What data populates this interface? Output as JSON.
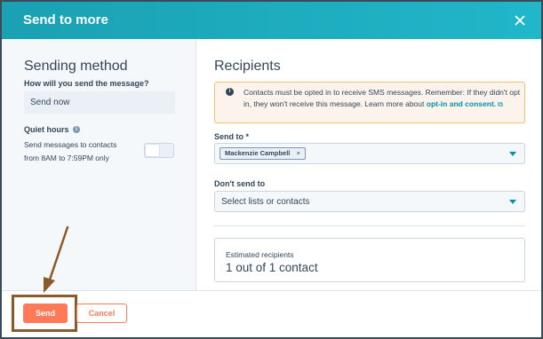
{
  "header": {
    "title": "Send to more",
    "close_icon": "close-icon"
  },
  "sending_method": {
    "title": "Sending method",
    "how_label": "How will you send the message?",
    "method_value": "Send now",
    "quiet_hours_label": "Quiet hours",
    "quiet_hours_info_icon": "info-icon",
    "quiet_hours_desc_line1": "Send messages to contacts",
    "quiet_hours_desc_line2": "from 8AM to 7:59PM only",
    "quiet_hours_enabled": false
  },
  "recipients": {
    "title": "Recipients",
    "alert_icon": "info-icon",
    "alert_text": "Contacts must be opted in to receive SMS messages. Remember: If they didn't opt in, they won't receive this message. Learn more about",
    "alert_link": "opt-in and consent.",
    "send_to_label": "Send to *",
    "send_to_chip": "Mackenzie Campbell",
    "chip_remove": "×",
    "dont_send_label": "Don't send to",
    "dont_send_placeholder": "Select lists or contacts",
    "estimated_label": "Estimated recipients",
    "estimated_value": "1 out of 1 contact"
  },
  "footer": {
    "send_label": "Send",
    "cancel_label": "Cancel"
  },
  "colors": {
    "header_teal": "#1aa1b3",
    "accent_orange": "#ff7a59",
    "link_teal": "#0091ae",
    "annotation_brown": "#8b5a2b"
  }
}
